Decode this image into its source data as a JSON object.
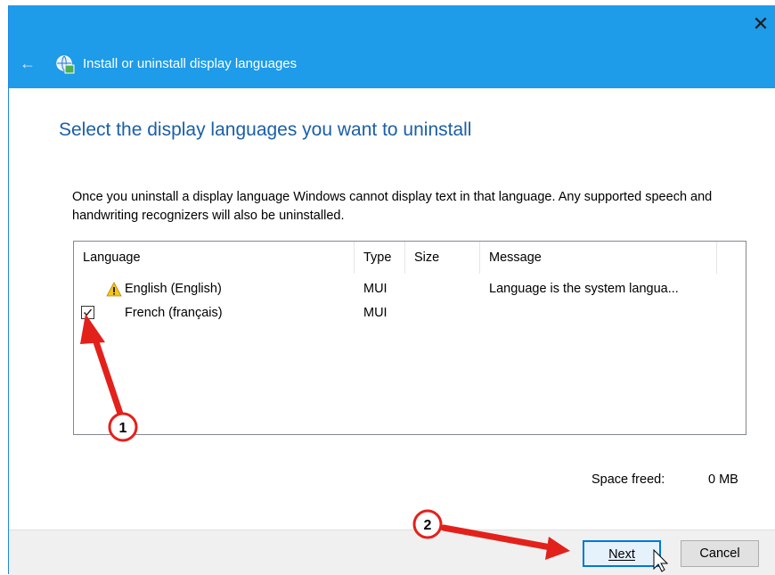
{
  "window": {
    "title": "Install or uninstall display languages",
    "close_glyph": "✕",
    "back_glyph": "←"
  },
  "page": {
    "heading": "Select the display languages you want to uninstall",
    "description": "Once you uninstall a display language Windows cannot display text in that language. Any supported speech and handwriting recognizers will also be uninstalled."
  },
  "list": {
    "columns": [
      "Language",
      "Type",
      "Size",
      "Message"
    ],
    "rows": [
      {
        "language": "English (English)",
        "type": "MUI",
        "size": "",
        "message": "Language is the system langua...",
        "checked": false,
        "warning": true
      },
      {
        "language": "French (français)",
        "type": "MUI",
        "size": "",
        "message": "",
        "checked": true,
        "warning": false
      }
    ]
  },
  "summary": {
    "space_freed_label": "Space freed:",
    "space_freed_value": "0 MB"
  },
  "buttons": {
    "next_label": "Next",
    "cancel_label": "Cancel"
  },
  "annotations": {
    "marker_1": "1",
    "marker_2": "2",
    "arrow_color": "#e3211b"
  },
  "colors": {
    "titlebar": "#1e9be9",
    "heading": "#1a5fa8",
    "accent": "#0078d7"
  }
}
